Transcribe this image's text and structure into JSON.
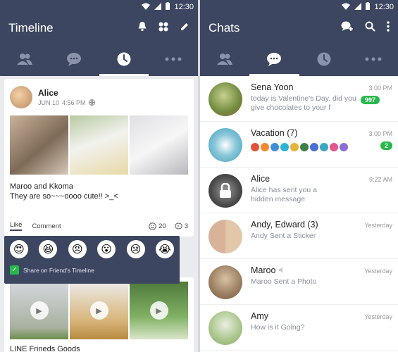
{
  "status_bar": {
    "time": "12:30"
  },
  "timeline": {
    "title": "Timeline",
    "post": {
      "author": "Alice",
      "date": "JUN 10",
      "time": "4:56 PM",
      "text_line1": "Maroo and Kkoma",
      "text_line2": "They are so~~~oooo cute!! >_<",
      "like_label": "Like",
      "comment_label": "Comment",
      "reaction_count": "20",
      "comment_count": "3"
    },
    "share_label": "Share on Friend's Timeline",
    "post2_text": "LINE Frineds Goods"
  },
  "chats": {
    "title": "Chats",
    "items": [
      {
        "name": "Sena Yoon",
        "time": "3:00 PM",
        "message": "today is Valentine's Day. did you give chocolates to your f",
        "badge": "997"
      },
      {
        "name": "Vacation (7)",
        "time": "3:00 PM",
        "message": "",
        "badge": "2"
      },
      {
        "name": "Alice",
        "time": "9:22 AM",
        "message": "Alice has sent you a hidden message",
        "badge": ""
      },
      {
        "name": "Andy, Edward (3)",
        "time": "Yesterday",
        "message": "Andy Sent a Sticker",
        "badge": ""
      },
      {
        "name": "Maroo",
        "time": "Yesterday",
        "message": "Maroo Sent a Photo",
        "badge": ""
      },
      {
        "name": "Amy",
        "time": "Yesterday",
        "message": "How is it Going?",
        "badge": ""
      }
    ]
  },
  "colors": {
    "header": "#3d4660",
    "badge": "#26b94a"
  }
}
